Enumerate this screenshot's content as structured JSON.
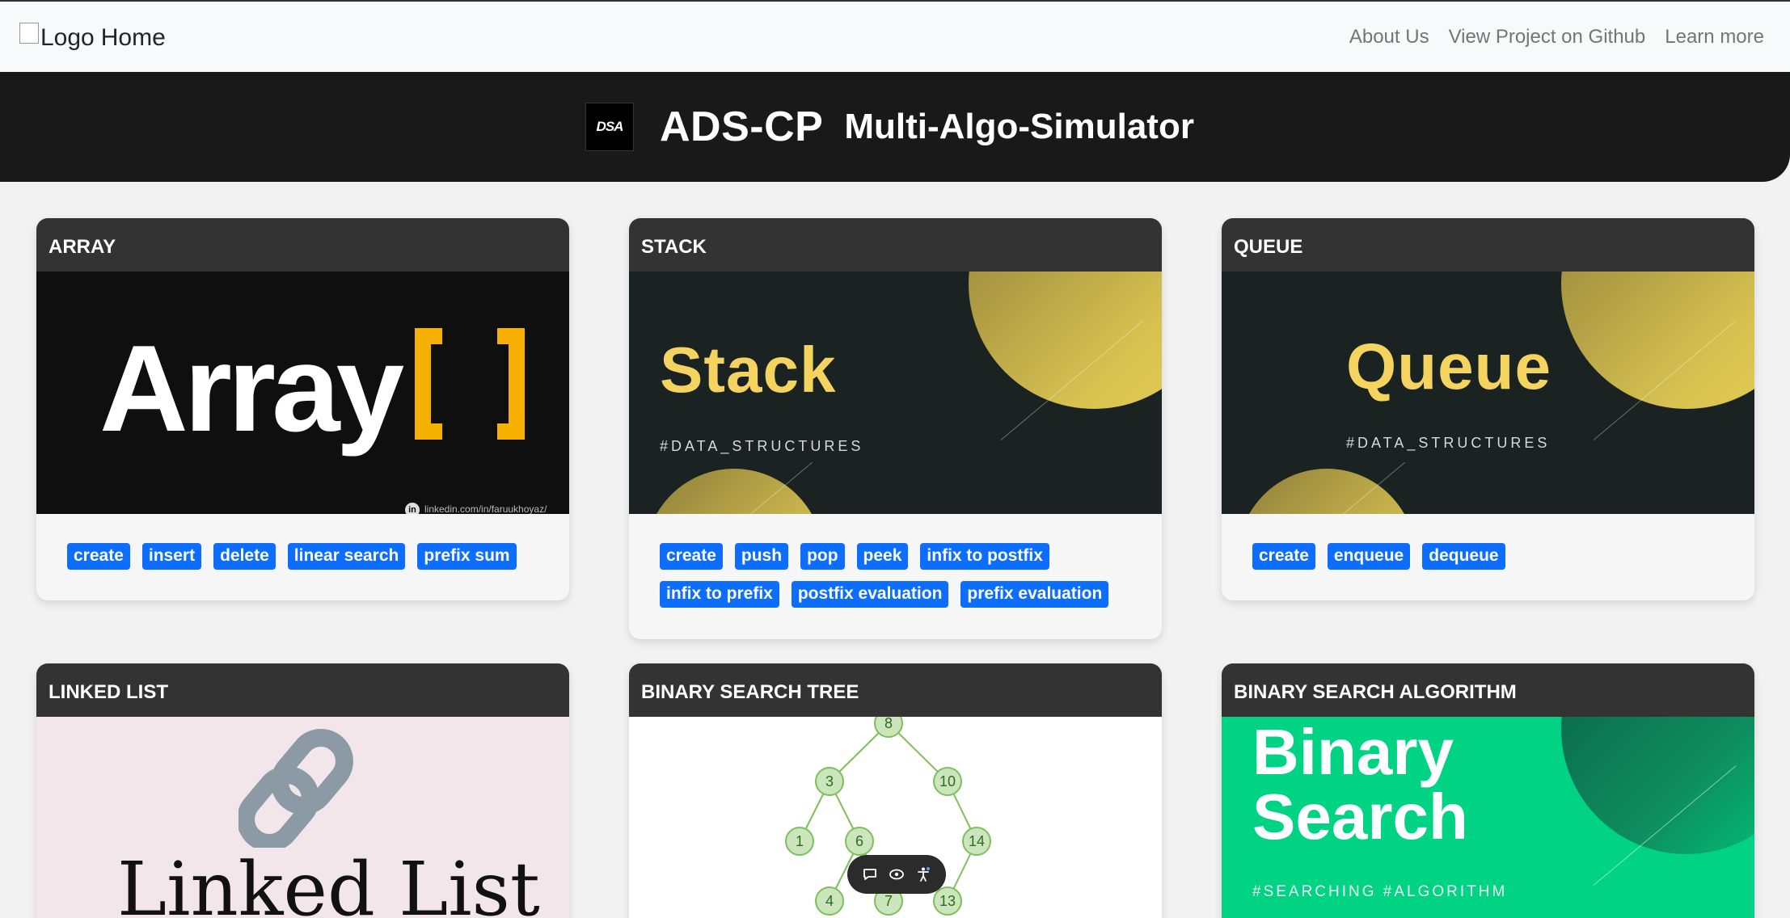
{
  "navbar": {
    "brand_img_alt": "Logo",
    "brand_text": "Home",
    "links": [
      "About Us",
      "View Project on Github",
      "Learn more"
    ]
  },
  "header": {
    "logo_text": "DSA",
    "title": "ADS-CP",
    "subtitle": "Multi-Algo-Simulator"
  },
  "cards": [
    {
      "title": "ARRAY",
      "image": {
        "word": "Array",
        "footer": "linkedin.com/in/faruukhoyaz/",
        "footer_badge": "in"
      },
      "tags": [
        "create",
        "insert",
        "delete",
        "linear search",
        "prefix sum"
      ]
    },
    {
      "title": "STACK",
      "image": {
        "word": "Stack",
        "hashtag": "#DATA_STRUCTURES"
      },
      "tags": [
        "create",
        "push",
        "pop",
        "peek",
        "infix to postfix",
        "infix to prefix",
        "postfix evaluation",
        "prefix evaluation"
      ]
    },
    {
      "title": "QUEUE",
      "image": {
        "word": "Queue",
        "hashtag": "#DATA_STRUCTURES"
      },
      "tags": [
        "create",
        "enqueue",
        "dequeue"
      ]
    },
    {
      "title": "LINKED LIST",
      "image": {
        "word": "Linked List"
      }
    },
    {
      "title": "BINARY SEARCH TREE",
      "image": {
        "nodes": [
          "8",
          "3",
          "10",
          "1",
          "6",
          "14",
          "4",
          "7",
          "13"
        ]
      }
    },
    {
      "title": "BINARY SEARCH ALGORITHM",
      "image": {
        "line1": "Binary",
        "line2": "Search",
        "hashtag": "#SEARCHING #ALGORITHM"
      }
    }
  ],
  "colors": {
    "tag_bg": "#0d6efd",
    "card_header": "#333333",
    "banner_bg": "#191919",
    "accent_yellow": "#f4d35e",
    "accent_green": "#00d383"
  },
  "float_toolbar": {
    "icons": [
      "comment-icon",
      "eye-icon",
      "accessibility-icon"
    ]
  }
}
